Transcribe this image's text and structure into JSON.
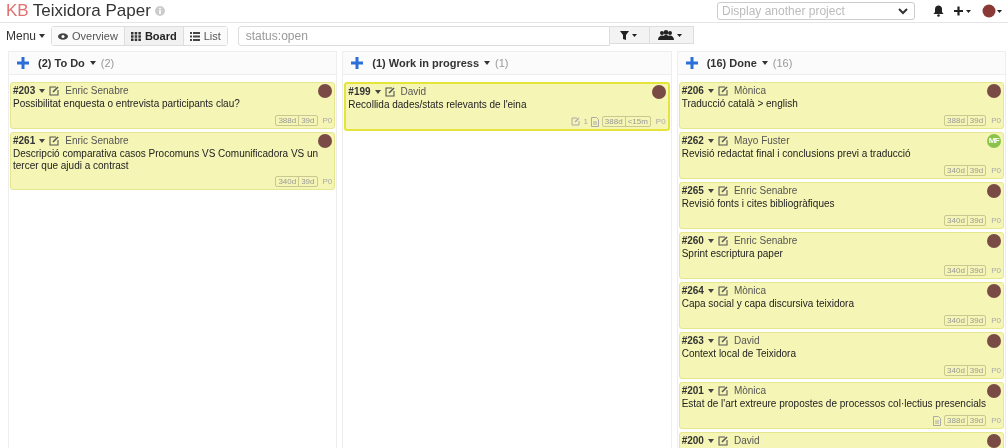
{
  "header": {
    "logo": "KB",
    "title": "Teixidora Paper",
    "project_select": {
      "placeholder": "Display another project"
    }
  },
  "toolbar": {
    "menu": "Menu",
    "views": [
      {
        "label": "Overview",
        "selected": false
      },
      {
        "label": "Board",
        "selected": true
      },
      {
        "label": "List",
        "selected": false
      }
    ],
    "search": {
      "value": "status:open"
    }
  },
  "columns": [
    {
      "title": "(2) To Do",
      "count": "(2)",
      "cards": [
        {
          "id": "#203",
          "assignee": "Enric Senabre",
          "avatar": {
            "kind": "photo"
          },
          "title": "Possibilitat enquesta o entrevista participants clau?",
          "badges": [
            "388d",
            "39d"
          ],
          "priority": "P0",
          "highlighted": false
        },
        {
          "id": "#261",
          "assignee": "Enric Senabre",
          "avatar": {
            "kind": "photo"
          },
          "title": "Descripció comparativa casos Procomuns VS Comunificadora VS un tercer que ajudi a contrast",
          "badges": [
            "340d",
            "39d"
          ],
          "priority": "P0",
          "highlighted": false
        }
      ]
    },
    {
      "title": "(1) Work in progress",
      "count": "(1)",
      "cards": [
        {
          "id": "#199",
          "assignee": "David",
          "avatar": {
            "kind": "photo"
          },
          "title": "Recollida dades/stats relevants de l'eina",
          "links": "1",
          "attachment": true,
          "badges": [
            "388d",
            "<15m"
          ],
          "priority": "P0",
          "highlighted": true
        }
      ]
    },
    {
      "title": "(16) Done",
      "count": "(16)",
      "cards": [
        {
          "id": "#206",
          "assignee": "Mònica",
          "avatar": {
            "kind": "photo"
          },
          "title": "Traducció català > english",
          "badges": [
            "388d",
            "39d"
          ],
          "priority": "P0",
          "highlighted": false
        },
        {
          "id": "#262",
          "assignee": "Mayo Fuster",
          "avatar": {
            "kind": "initials",
            "text": "MF"
          },
          "title": "Revisió redactat final i conclusions previ a traducció",
          "badges": [
            "340d",
            "39d"
          ],
          "priority": "P0",
          "highlighted": false
        },
        {
          "id": "#265",
          "assignee": "Enric Senabre",
          "avatar": {
            "kind": "photo"
          },
          "title": "Revisió fonts i cites bibliogràfiques",
          "badges": [
            "340d",
            "39d"
          ],
          "priority": "P0",
          "highlighted": false
        },
        {
          "id": "#260",
          "assignee": "Enric Senabre",
          "avatar": {
            "kind": "photo"
          },
          "title": "Sprint escriptura paper",
          "badges": [
            "340d",
            "39d"
          ],
          "priority": "P0",
          "highlighted": false
        },
        {
          "id": "#264",
          "assignee": "Mònica",
          "avatar": {
            "kind": "photo"
          },
          "title": "Capa social y capa discursiva teixidora",
          "badges": [
            "340d",
            "39d"
          ],
          "priority": "P0",
          "highlighted": false
        },
        {
          "id": "#263",
          "assignee": "David",
          "avatar": {
            "kind": "photo"
          },
          "title": "Context local de Teixidora",
          "badges": [
            "340d",
            "39d"
          ],
          "priority": "P0",
          "highlighted": false
        },
        {
          "id": "#201",
          "assignee": "Mònica",
          "avatar": {
            "kind": "photo"
          },
          "title": "Estat de l'art extreure propostes de processos col·lectius presencials",
          "attachment": true,
          "badges": [
            "388d",
            "39d"
          ],
          "priority": "P0",
          "highlighted": false
        },
        {
          "id": "#200",
          "assignee": "David",
          "avatar": {
            "kind": "photo"
          },
          "highlighted": false
        }
      ]
    }
  ]
}
